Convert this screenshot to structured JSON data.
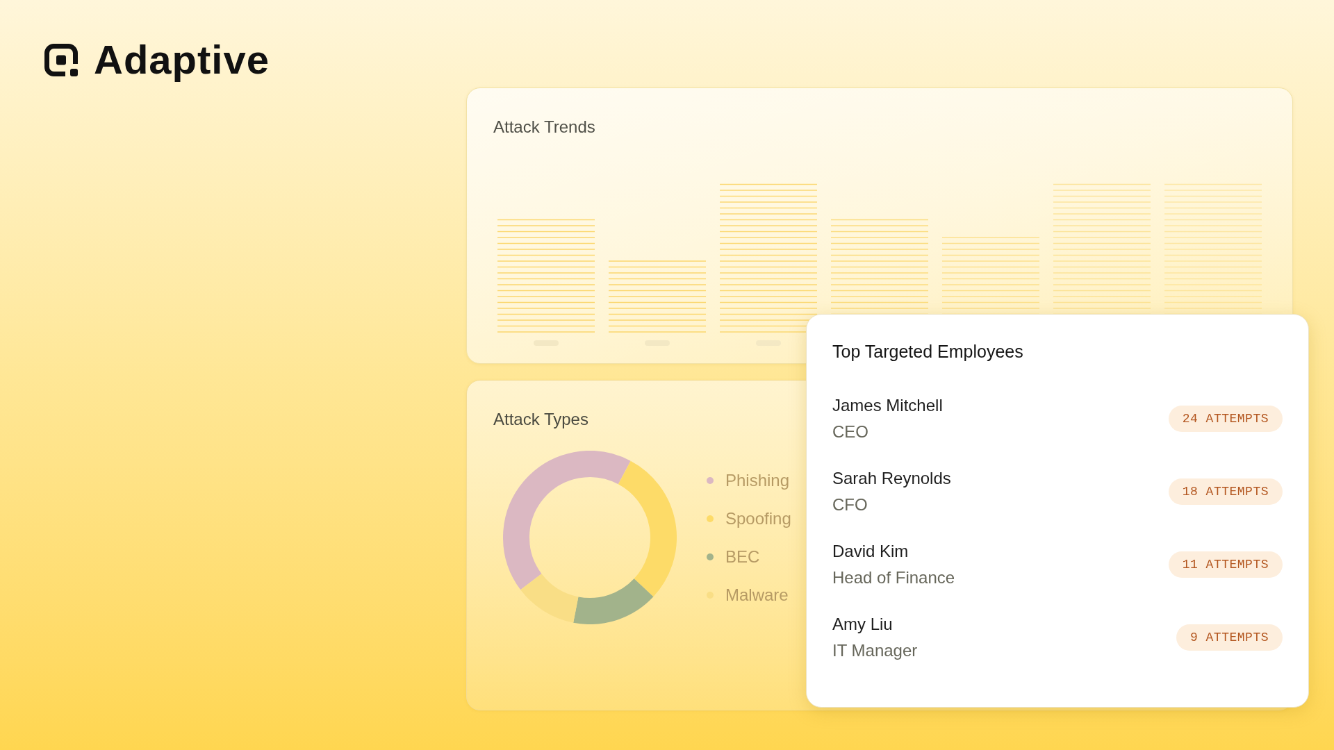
{
  "logo": {
    "text": "Adaptive"
  },
  "attack_trends": {
    "title": "Attack Trends"
  },
  "attack_types": {
    "title": "Attack Types",
    "legend": [
      {
        "label": "Phishing",
        "color": "#dbb8c2"
      },
      {
        "label": "Spoofing",
        "color": "#fddb68"
      },
      {
        "label": "BEC",
        "color": "#a2b38b"
      },
      {
        "label": "Malware",
        "color": "#f9de86"
      }
    ]
  },
  "top_targeted_employees": {
    "title": "Top Targeted Employees",
    "employees": [
      {
        "name": "James Mitchell",
        "role": "CEO",
        "attempts": "24 ATTEMPTS"
      },
      {
        "name": "Sarah Reynolds",
        "role": "CFO",
        "attempts": "18 ATTEMPTS"
      },
      {
        "name": "David Kim",
        "role": "Head of Finance",
        "attempts": "11 ATTEMPTS"
      },
      {
        "name": "Amy Liu",
        "role": "IT Manager",
        "attempts": "9 ATTEMPTS"
      }
    ]
  }
}
